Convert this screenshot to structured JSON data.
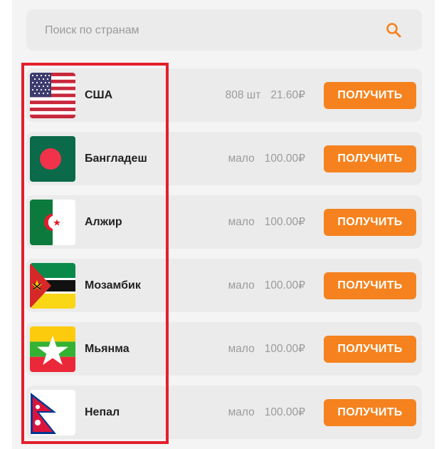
{
  "search": {
    "placeholder": "Поиск по странам",
    "icon": "search-icon",
    "icon_color": "#f5821e"
  },
  "colors": {
    "accent": "#f5821e",
    "highlight": "#e3202a",
    "muted_text": "#9b9b9b"
  },
  "countries": [
    {
      "name": "США",
      "quantity": "808 шт",
      "price": "21.60₽",
      "button_label": "ПОЛУЧИТЬ",
      "flag": "usa-flag"
    },
    {
      "name": "Бангладеш",
      "quantity": "мало",
      "price": "100.00₽",
      "button_label": "ПОЛУЧИТЬ",
      "flag": "bangladesh-flag"
    },
    {
      "name": "Алжир",
      "quantity": "мало",
      "price": "100.00₽",
      "button_label": "ПОЛУЧИТЬ",
      "flag": "algeria-flag"
    },
    {
      "name": "Мозамбик",
      "quantity": "мало",
      "price": "100.00₽",
      "button_label": "ПОЛУЧИТЬ",
      "flag": "mozambique-flag"
    },
    {
      "name": "Мьянма",
      "quantity": "мало",
      "price": "100.00₽",
      "button_label": "ПОЛУЧИТЬ",
      "flag": "myanmar-flag"
    },
    {
      "name": "Непал",
      "quantity": "мало",
      "price": "100.00₽",
      "button_label": "ПОЛУЧИТЬ",
      "flag": "nepal-flag"
    }
  ]
}
